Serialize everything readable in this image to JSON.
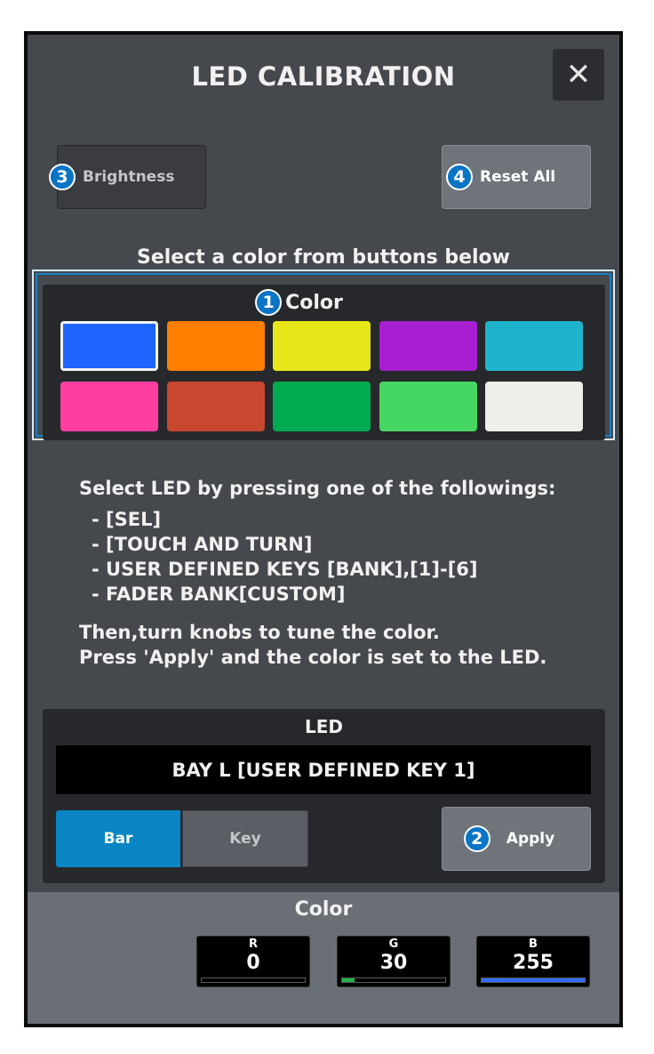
{
  "dialog": {
    "title": "LED CALIBRATION",
    "close_glyph": "✕"
  },
  "top_buttons": {
    "brightness": {
      "badge": "3",
      "label": "Brightness"
    },
    "reset_all": {
      "badge": "4",
      "label": "Reset All"
    }
  },
  "select_hint": "Select a color from buttons below",
  "color_panel": {
    "badge": "1",
    "title": "Color",
    "selected_index": 0,
    "swatches": [
      "#1e64ff",
      "#ff7f00",
      "#e6e619",
      "#a61ed0",
      "#20b4cc",
      "#ff3f9f",
      "#c8472f",
      "#00aa50",
      "#46d662",
      "#eeeeea"
    ]
  },
  "instructions": {
    "heading": "Select LED by pressing one of the followings:",
    "items": [
      "- [SEL]",
      "- [TOUCH AND TURN]",
      "- USER DEFINED KEYS [BANK],[1]-[6]",
      "- FADER BANK[CUSTOM]"
    ],
    "line1": "Then,turn knobs to tune the color.",
    "line2": "Press 'Apply' and the color is set to the LED."
  },
  "led_panel": {
    "label": "LED",
    "name": "BAY L [USER DEFINED KEY 1]",
    "bar_label": "Bar",
    "key_label": "Key",
    "selected_segment": "Bar",
    "apply": {
      "badge": "2",
      "label": "Apply"
    }
  },
  "rgb": {
    "title": "Color",
    "channels": [
      {
        "label": "R",
        "value": "0",
        "level": 0,
        "color": "#d93030"
      },
      {
        "label": "G",
        "value": "30",
        "level": 0.118,
        "color": "#22b34a"
      },
      {
        "label": "B",
        "value": "255",
        "level": 1.0,
        "color": "#2f6bff"
      }
    ]
  }
}
